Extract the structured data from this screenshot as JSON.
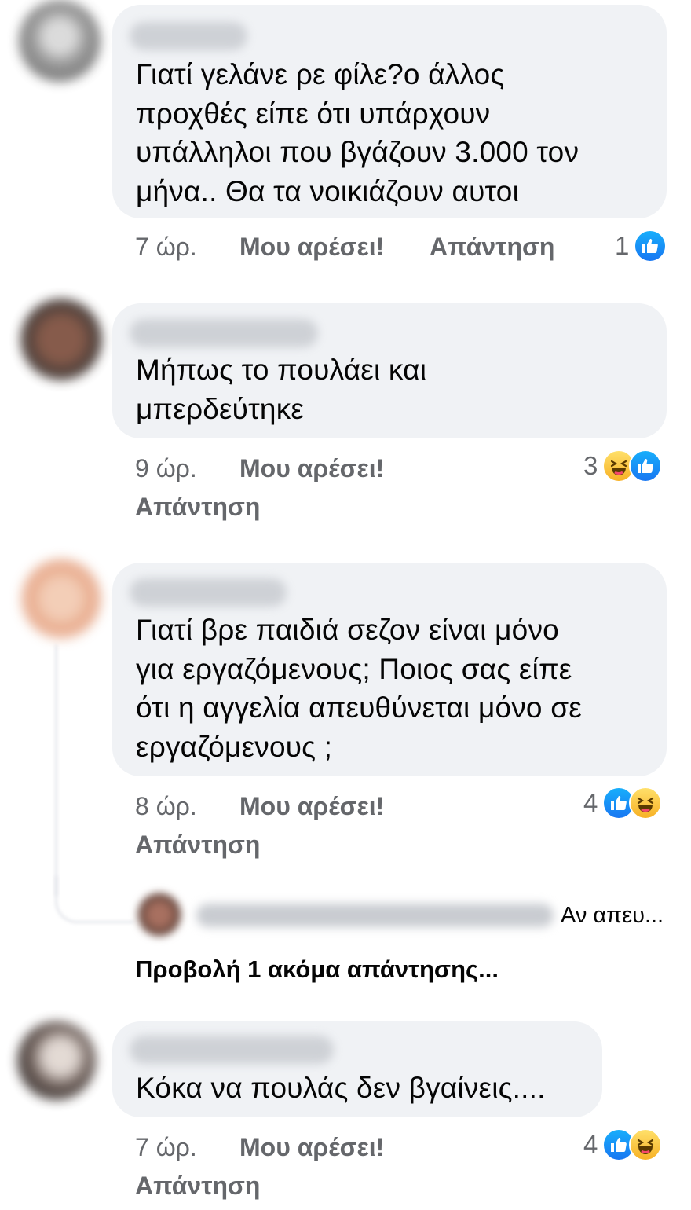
{
  "comments": [
    {
      "author": "",
      "text": "Γιατί γελάνε ρε φίλε?ο άλλος\nπροχθές είπε ότι υπάρχουν\nυπάλληλοι που βγάζουν 3.000 τον\nμήνα.. Θα τα νοικιάζουν αυτοι",
      "time": "7 ώρ.",
      "like_label": "Μου αρέσει!",
      "reply_label": "Απάντηση",
      "reaction_count": "1",
      "reactions": [
        "like-icon"
      ]
    },
    {
      "author": "",
      "text": "Μήπως το πουλάει και\nμπερδεύτηκε",
      "time": "9 ώρ.",
      "like_label": "Μου αρέσει!",
      "reply_label": "Απάντηση",
      "reaction_count": "3",
      "reactions": [
        "haha-icon",
        "like-icon"
      ]
    },
    {
      "author": "",
      "text": "Γιατί βρε παιδιά σεζον είναι μόνο\nγια εργαζόμενους; Ποιος σας είπε\nότι η αγγελία απευθύνεται μόνο σε\nεργαζόμενους ;",
      "time": "8 ώρ.",
      "like_label": "Μου αρέσει!",
      "reply_label": "Απάντηση",
      "reaction_count": "4",
      "reactions": [
        "like-icon",
        "haha-icon"
      ],
      "reply_preview": {
        "author": "",
        "snippet": "Αν απευ..."
      },
      "more_replies_label": "Προβολή 1 ακόμα απάντησης..."
    },
    {
      "author": "",
      "text": "Κόκα να πουλάς δεν βγαίνεις....",
      "time": "7 ώρ.",
      "like_label": "Μου αρέσει!",
      "reply_label": "Απάντηση",
      "reaction_count": "4",
      "reactions": [
        "like-icon",
        "haha-icon"
      ]
    }
  ],
  "colors": {
    "bubble": "#f0f2f5",
    "meta_text": "#65676b",
    "like_blue": "#1877f2",
    "haha_yellow": "#f7b125"
  }
}
